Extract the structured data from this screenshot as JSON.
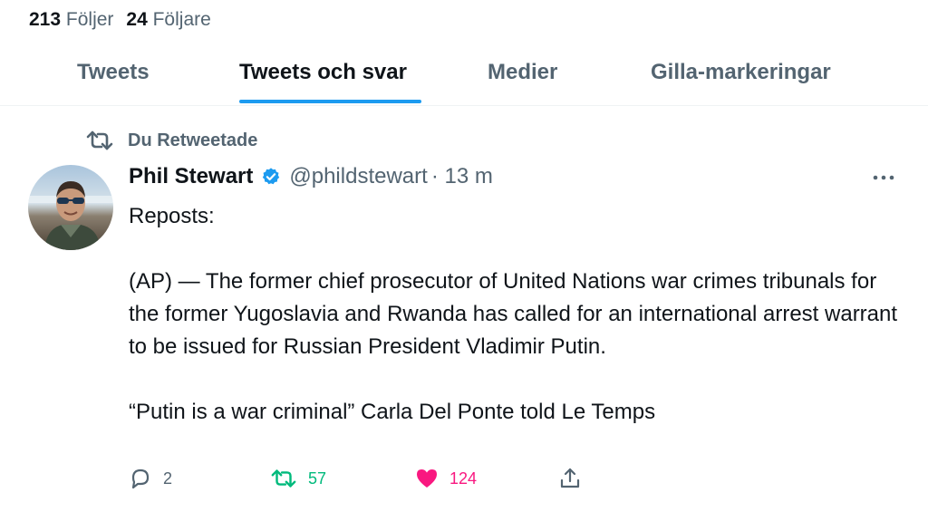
{
  "profile": {
    "following_count": "213",
    "following_label": "Följer",
    "followers_count": "24",
    "followers_label": "Följare"
  },
  "tabs": [
    {
      "label": "Tweets",
      "active": false
    },
    {
      "label": "Tweets och svar",
      "active": true
    },
    {
      "label": "Medier",
      "active": false
    },
    {
      "label": "Gilla-markeringar",
      "active": false
    }
  ],
  "tweet": {
    "retweet_label": "Du Retweetade",
    "author_name": "Phil Stewart",
    "handle": "@phildstewart",
    "time": "· 13 m",
    "verified": true,
    "paragraphs": [
      "Reposts:",
      "",
      "(AP) — The former chief prosecutor of United Nations war crimes tribunals for the former Yugoslavia and Rwanda has called for an international arrest warrant to be issued for Russian President Vladimir Putin.",
      "",
      "“Putin is a war criminal” Carla Del Ponte told Le Temps"
    ],
    "actions": {
      "replies": "2",
      "retweets": "57",
      "likes": "124"
    }
  },
  "colors": {
    "accent": "#1d9bf0",
    "retweet_green": "#00ba7c",
    "like_pink": "#f91880",
    "muted": "#536471"
  },
  "icons": [
    "retweet-icon",
    "verified-badge-icon",
    "more-icon",
    "reply-icon",
    "retweet-icon",
    "heart-icon",
    "share-icon"
  ]
}
